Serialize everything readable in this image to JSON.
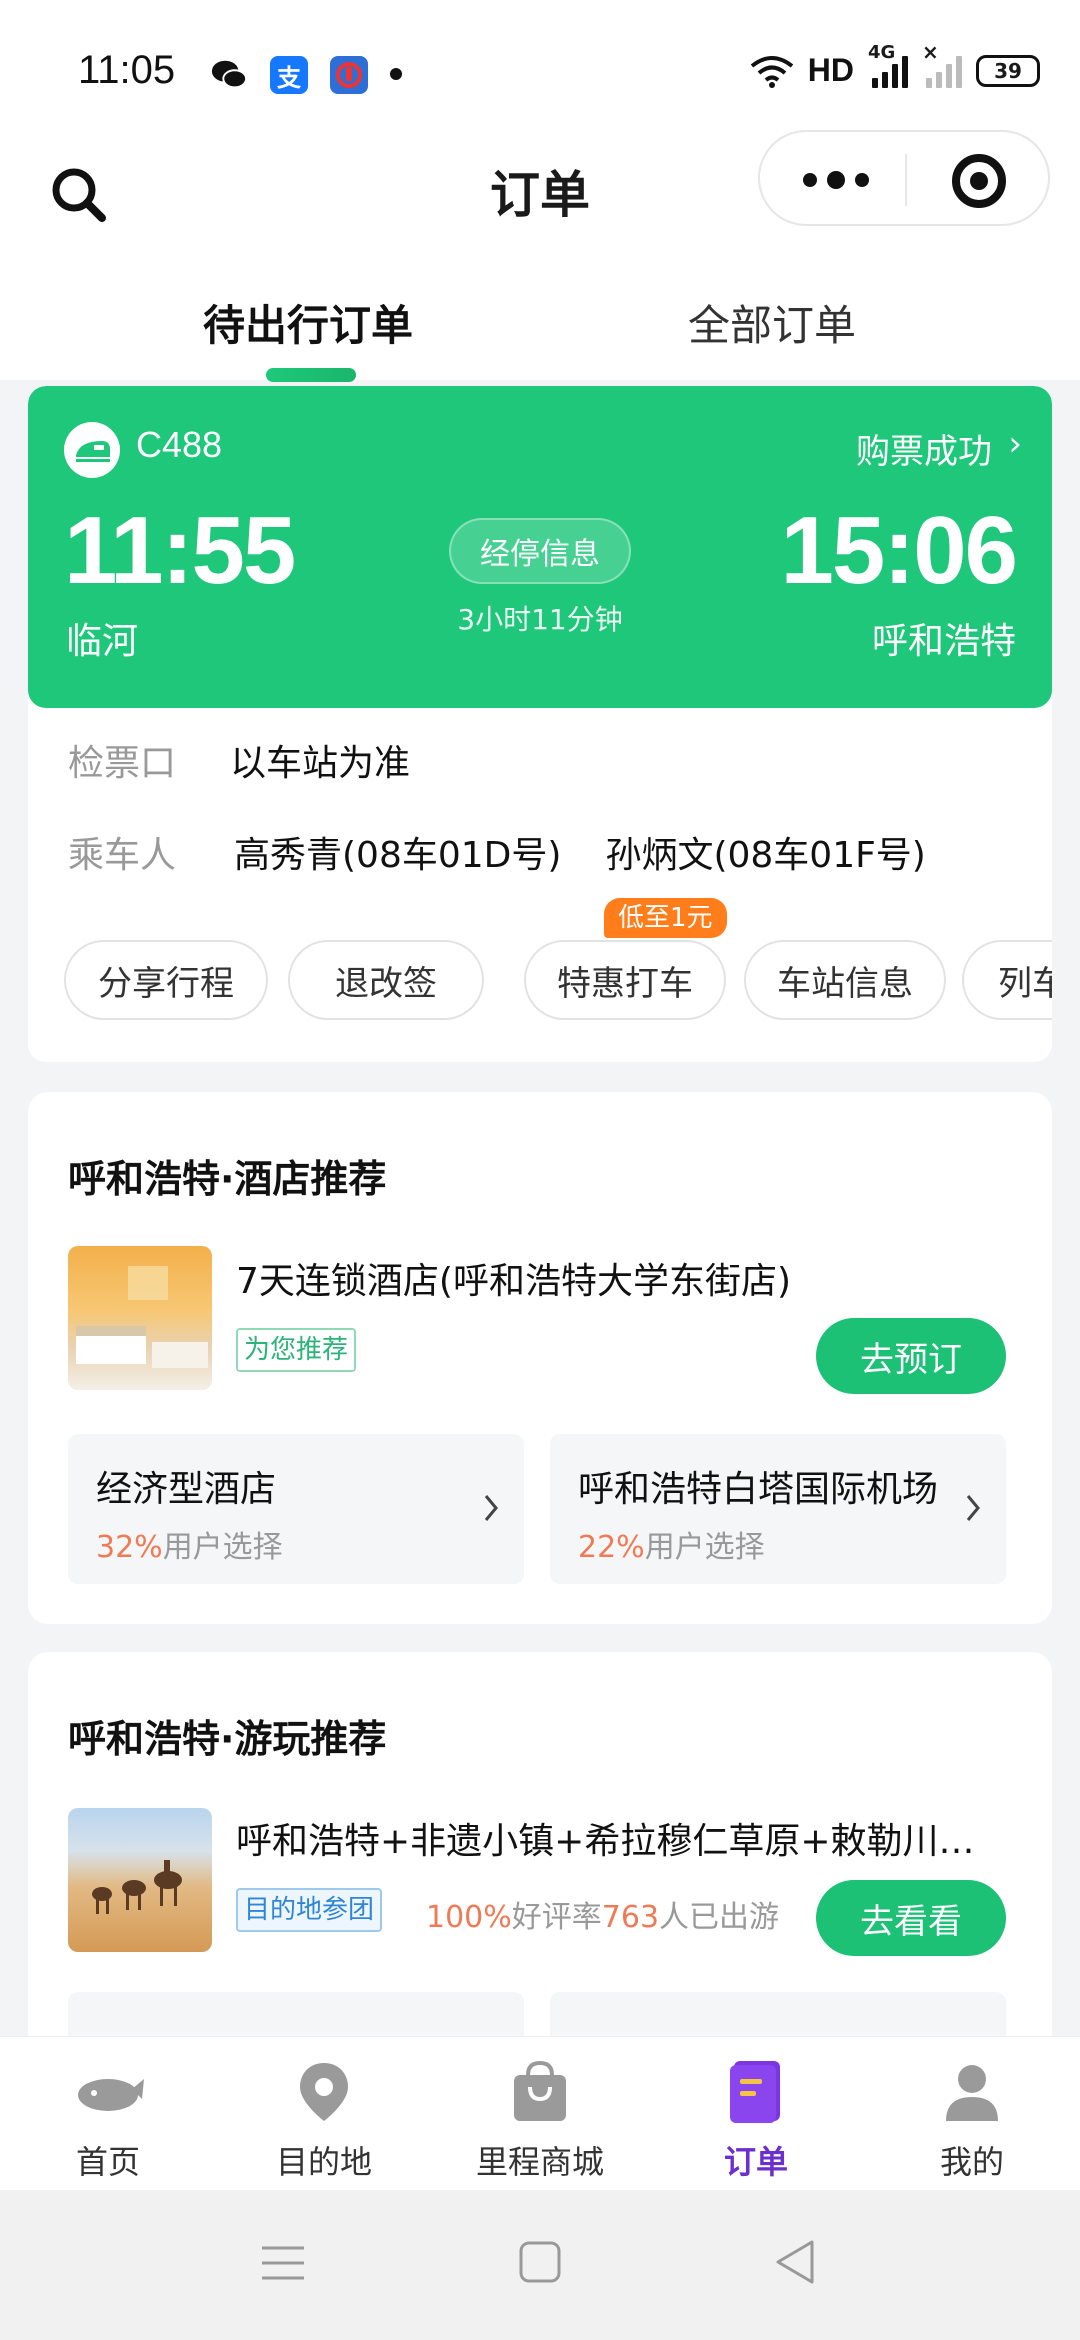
{
  "status_bar": {
    "time": "11:05",
    "network": "HD",
    "signal_label": "4G",
    "battery": "39"
  },
  "header": {
    "title": "订单",
    "tabs": [
      {
        "label": "待出行订单",
        "active": true
      },
      {
        "label": "全部订单",
        "active": false
      }
    ]
  },
  "train": {
    "number": "C488",
    "status": "购票成功",
    "depart_time": "11:55",
    "arrive_time": "15:06",
    "depart_station": "临河",
    "arrive_station": "呼和浩特",
    "stops_button": "经停信息",
    "duration": "3小时11分钟",
    "check_in_label": "检票口",
    "check_in_value": "以车站为准",
    "passenger_label": "乘车人",
    "passengers": [
      "高秀青(08车01D号)",
      "孙炳文(08车01F号)"
    ],
    "actions": [
      "分享行程",
      "退改签",
      "特惠打车",
      "车站信息",
      "列车信"
    ],
    "promo_badge": "低至1元",
    "accent_color": "#1ec77a"
  },
  "hotel": {
    "title": "呼和浩特·酒店推荐",
    "item_name": "7天连锁酒店(呼和浩特大学东街店)",
    "tag": "为您推荐",
    "cta": "去预订",
    "options": [
      {
        "title": "经济型酒店",
        "pct": "32%",
        "suffix": "用户选择"
      },
      {
        "title": "呼和浩特白塔国际机场",
        "pct": "22%",
        "suffix": "用户选择"
      }
    ]
  },
  "tour": {
    "title": "呼和浩特·游玩推荐",
    "item_name": "呼和浩特+非遗小镇+希拉穆仁草原+敕勒川…",
    "tag": "目的地参团",
    "rating_pct": "100%",
    "rating_label": "好评率",
    "travelers": "763",
    "travelers_label": "人已出游",
    "cta": "去看看"
  },
  "bottom_nav": [
    {
      "label": "首页",
      "icon": "whale-home-icon",
      "active": false
    },
    {
      "label": "目的地",
      "icon": "location-pin-icon",
      "active": false
    },
    {
      "label": "里程商城",
      "icon": "shopping-bag-icon",
      "active": false
    },
    {
      "label": "订单",
      "icon": "order-book-icon",
      "active": true
    },
    {
      "label": "我的",
      "icon": "user-icon",
      "active": false
    }
  ]
}
